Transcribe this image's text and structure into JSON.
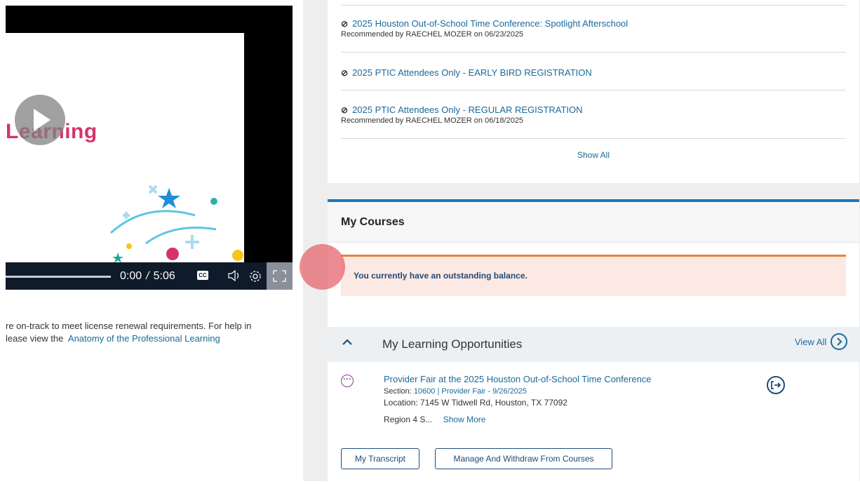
{
  "video": {
    "slide_title": "Learning",
    "time_current": "0:00",
    "time_separator": "/",
    "time_total": "5:06",
    "cc_label": "CC"
  },
  "left": {
    "description_line1": "re on-track to meet license renewal requirements. For help in",
    "description_line2_prefix": "lease view the",
    "description_link": "Anatomy of the Professional Learning"
  },
  "recommendations": {
    "items": [
      {
        "title": "2025 Houston Out-of-School Time Conference: Spotlight Afterschool",
        "by": "Recommended by RAECHEL MOZER on 06/23/2025"
      },
      {
        "title": "2025 PTIC Attendees Only - EARLY BIRD REGISTRATION",
        "by": ""
      },
      {
        "title": "2025 PTIC Attendees Only - REGULAR REGISTRATION",
        "by": "Recommended by RAECHEL MOZER on 06/18/2025"
      }
    ],
    "show_all": "Show All"
  },
  "courses": {
    "title": "My Courses",
    "alert": "You currently have an outstanding balance.",
    "learning_opportunities": {
      "title": "My Learning Opportunities",
      "view_all": "View All"
    },
    "item": {
      "title": "Provider Fair at the 2025 Houston Out-of-School Time Conference",
      "section_label": "Section:",
      "section_value": "10600 | Provider Fair - 9/26/2025",
      "location": "Location: 7145 W Tidwell Rd, Houston, TX 77092",
      "region": "Region 4 S...",
      "show_more": "Show More"
    },
    "buttons": {
      "transcript": "My Transcript",
      "manage": "Manage And Withdraw From Courses"
    }
  },
  "colors": {
    "link": "#1a6a9a",
    "accent_bar": "#1a7abf",
    "alert_border": "#e8823a",
    "alert_bg": "#fde9e3",
    "marker": "#e6646e"
  }
}
